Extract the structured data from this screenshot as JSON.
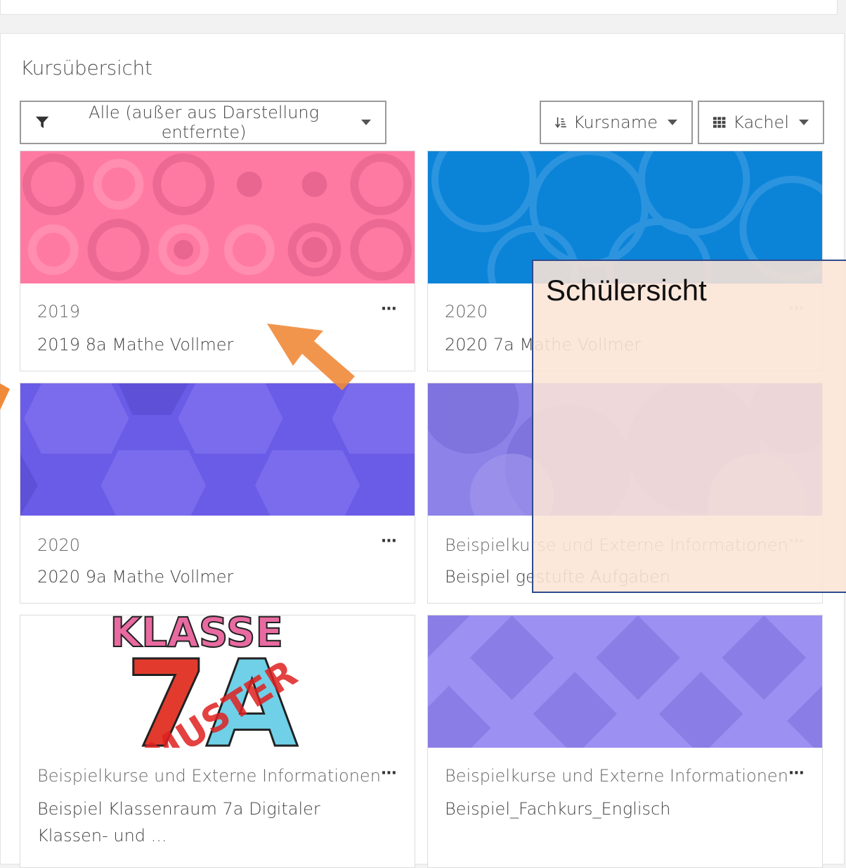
{
  "panel": {
    "title": "Kursübersicht"
  },
  "toolbar": {
    "filter_label": "Alle (außer aus Darstellung entfernte)",
    "sort_label": "Kursname",
    "view_label": "Kachel"
  },
  "courses": [
    {
      "category": "2019",
      "name": "2019 8a Mathe Vollmer",
      "image_color": "#ff7aa2",
      "menu": "···"
    },
    {
      "category": "2020",
      "name": "2020 7a Mathe Vollmer",
      "image_color": "#0b84d8",
      "menu": "···"
    },
    {
      "category": "2020",
      "name": "2020 9a Mathe Vollmer",
      "image_color": "#6b5ce7",
      "menu": "···"
    },
    {
      "category": "Beispielkurse und Externe Informationen",
      "name": "Beispiel gestufte Aufgaben",
      "image_color": "#8c82e8",
      "menu": "···"
    },
    {
      "category": "Beispielkurse und Externe Informationen",
      "name": "Beispiel Klassenraum 7a Digitaler Klassen- und ...",
      "image_text": "KLASSE 7A",
      "menu": "···"
    },
    {
      "category": "Beispielkurse und Externe Informationen",
      "name": "Beispiel_Fachkurs_Englisch",
      "image_color": "#9c90f2",
      "menu": "···"
    }
  ],
  "annotation": {
    "label": "Schülersicht",
    "arrow_color": "#ef8a3a"
  }
}
